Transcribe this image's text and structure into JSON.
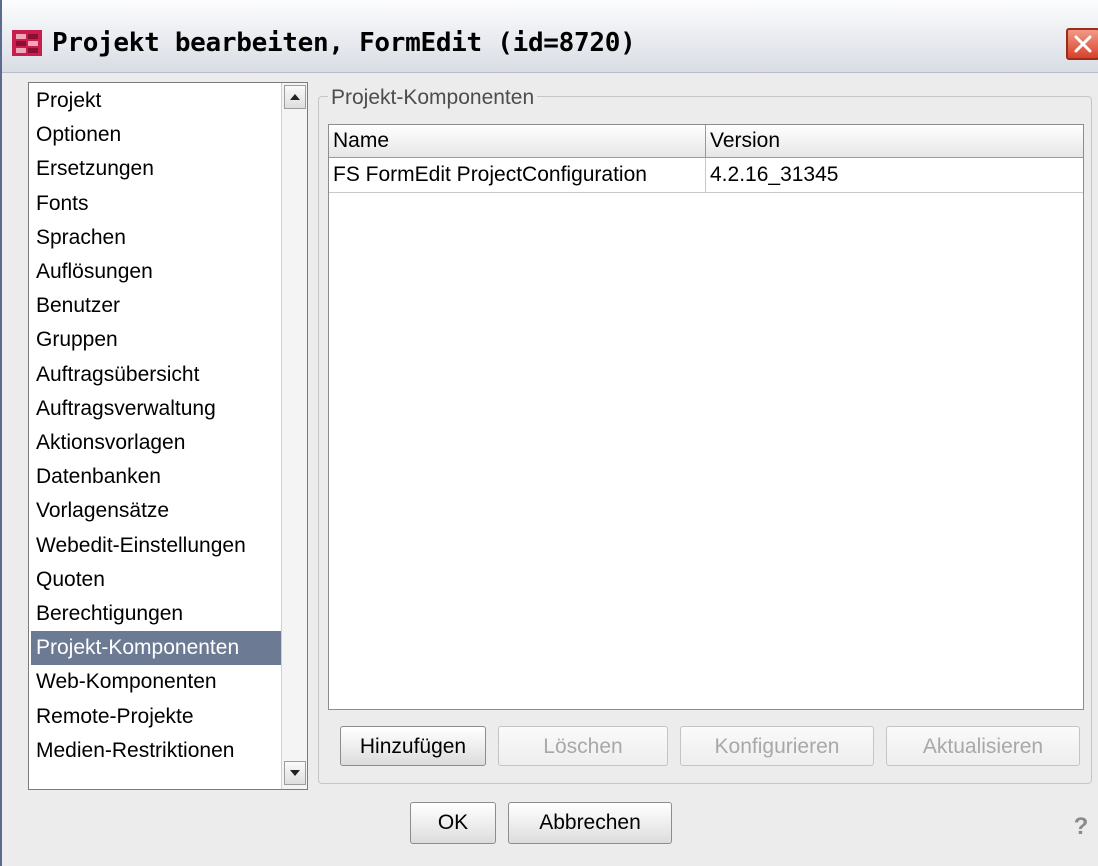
{
  "window": {
    "title": "Projekt bearbeiten, FormEdit (id=8720)",
    "accent_color": "#c81e4e",
    "close_icon": "close-icon"
  },
  "sidebar": {
    "items": [
      "Projekt",
      "Optionen",
      "Ersetzungen",
      "Fonts",
      "Sprachen",
      "Auflösungen",
      "Benutzer",
      "Gruppen",
      "Auftragsübersicht",
      "Auftragsverwaltung",
      "Aktionsvorlagen",
      "Datenbanken",
      "Vorlagensätze",
      "Webedit-Einstellungen",
      "Quoten",
      "Berechtigungen",
      "Projekt-Komponenten",
      "Web-Komponenten",
      "Remote-Projekte",
      "Medien-Restriktionen"
    ],
    "selected": "Projekt-Komponenten",
    "selected_color": "#6c7b93"
  },
  "panel": {
    "legend": "Projekt-Komponenten",
    "table": {
      "columns": [
        "Name",
        "Version"
      ],
      "rows": [
        [
          "FS FormEdit ProjectConfiguration",
          "4.2.16_31345"
        ]
      ]
    },
    "buttons": {
      "add": "Hinzufügen",
      "delete": "Löschen",
      "configure": "Konfigurieren",
      "update": "Aktualisieren"
    }
  },
  "footer": {
    "ok": "OK",
    "cancel": "Abbrechen",
    "help": "?"
  }
}
